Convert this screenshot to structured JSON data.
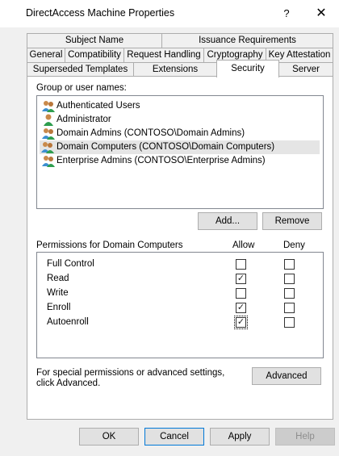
{
  "window": {
    "title": "DirectAccess Machine Properties",
    "help_glyph": "?",
    "close_glyph": "✕"
  },
  "tabs": {
    "row1": [
      "Subject Name",
      "Issuance Requirements"
    ],
    "row2": [
      "General",
      "Compatibility",
      "Request Handling",
      "Cryptography",
      "Key Attestation"
    ],
    "row3": [
      "Superseded Templates",
      "Extensions",
      "Security",
      "Server"
    ],
    "active": "Security"
  },
  "security": {
    "group_label": "Group or user names:",
    "principals": [
      {
        "name": "Authenticated Users",
        "icon": "users-group-icon"
      },
      {
        "name": "Administrator",
        "icon": "user-icon"
      },
      {
        "name": "Domain Admins (CONTOSO\\Domain Admins)",
        "icon": "users-group-icon"
      },
      {
        "name": "Domain Computers (CONTOSO\\Domain Computers)",
        "icon": "users-group-icon",
        "selected": true
      },
      {
        "name": "Enterprise Admins (CONTOSO\\Enterprise Admins)",
        "icon": "users-group-icon"
      }
    ],
    "add_label": "Add...",
    "remove_label": "Remove",
    "permissions_label": "Permissions for Domain Computers",
    "allow_header": "Allow",
    "deny_header": "Deny",
    "permissions": [
      {
        "name": "Full Control",
        "allow": false,
        "deny": false
      },
      {
        "name": "Read",
        "allow": true,
        "deny": false
      },
      {
        "name": "Write",
        "allow": false,
        "deny": false
      },
      {
        "name": "Enroll",
        "allow": true,
        "deny": false
      },
      {
        "name": "Autoenroll",
        "allow": true,
        "deny": false
      }
    ],
    "advanced_text": "For special permissions or advanced settings, click Advanced.",
    "advanced_label": "Advanced"
  },
  "footer": {
    "ok_label": "OK",
    "cancel_label": "Cancel",
    "apply_label": "Apply",
    "help_label": "Help"
  },
  "colors": {
    "accent": "#0078d7",
    "dialog_bg": "#f0f0f0",
    "selection_bg": "#e5e5e5"
  }
}
